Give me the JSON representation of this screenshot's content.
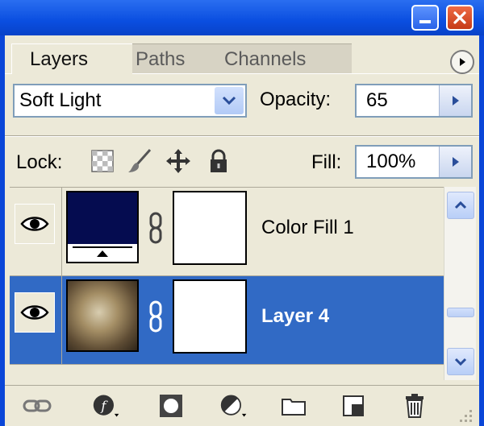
{
  "tabs": [
    {
      "label": "Layers",
      "active": true
    },
    {
      "label": "Paths",
      "active": false
    },
    {
      "label": "Channels",
      "active": false
    }
  ],
  "blend": {
    "mode": "Soft Light",
    "opacity_label": "Opacity:",
    "opacity_value": "65"
  },
  "lock": {
    "label": "Lock:",
    "fill_label": "Fill:",
    "fill_value": "100%"
  },
  "layers": [
    {
      "name": "Color Fill 1",
      "visible": true,
      "selected": false,
      "thumb_color": "#050c50"
    },
    {
      "name": "Layer 4",
      "visible": true,
      "selected": true
    }
  ],
  "colors": {
    "selection": "#316ac5",
    "panel": "#ece9d8",
    "titlebar": "#0a46d8"
  },
  "icons": [
    "minimize-icon",
    "close-icon",
    "panel-menu-icon",
    "link-layers-icon",
    "layer-style-icon",
    "add-mask-icon",
    "adjustment-layer-icon",
    "new-group-icon",
    "new-layer-icon",
    "trash-icon"
  ]
}
